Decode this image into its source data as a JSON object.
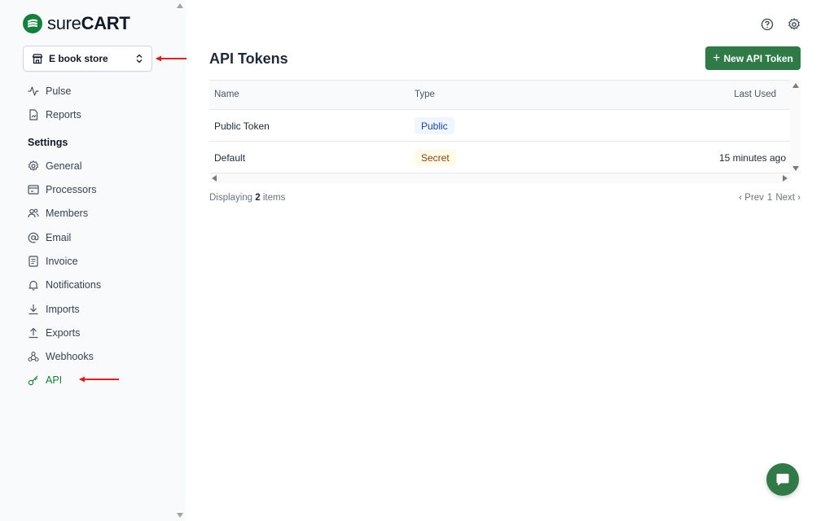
{
  "brand": {
    "name_light": "sure",
    "name_bold": "CART"
  },
  "store_selector": {
    "value": "E book store"
  },
  "nav": {
    "main": [
      {
        "id": "pulse",
        "label": "Pulse",
        "icon": "pulse-icon"
      },
      {
        "id": "reports",
        "label": "Reports",
        "icon": "reports-icon"
      }
    ],
    "settings_title": "Settings",
    "settings": [
      {
        "id": "general",
        "label": "General",
        "icon": "gear-icon"
      },
      {
        "id": "processors",
        "label": "Processors",
        "icon": "processors-icon"
      },
      {
        "id": "members",
        "label": "Members",
        "icon": "users-icon"
      },
      {
        "id": "email",
        "label": "Email",
        "icon": "at-icon"
      },
      {
        "id": "invoice",
        "label": "Invoice",
        "icon": "invoice-icon"
      },
      {
        "id": "notifications",
        "label": "Notifications",
        "icon": "bell-icon"
      },
      {
        "id": "imports",
        "label": "Imports",
        "icon": "download-icon"
      },
      {
        "id": "exports",
        "label": "Exports",
        "icon": "upload-icon"
      },
      {
        "id": "webhooks",
        "label": "Webhooks",
        "icon": "webhook-icon"
      },
      {
        "id": "api",
        "label": "API",
        "icon": "key-icon",
        "active": true
      }
    ]
  },
  "page": {
    "title": "API Tokens",
    "new_button": "New API Token"
  },
  "table": {
    "columns": {
      "name": "Name",
      "type": "Type",
      "last_used": "Last Used"
    },
    "rows": [
      {
        "name": "Public Token",
        "type": "Public",
        "last_used": ""
      },
      {
        "name": "Default",
        "type": "Secret",
        "last_used": "15 minutes ago"
      }
    ]
  },
  "footer": {
    "displaying_prefix": "Displaying",
    "count": "2",
    "displaying_suffix": "items",
    "prev": "‹ Prev",
    "page": "1",
    "next": "Next ›"
  },
  "colors": {
    "accent": "#2f7a47",
    "active_nav": "#15803d",
    "annotation_arrow": "#e11d1d"
  }
}
